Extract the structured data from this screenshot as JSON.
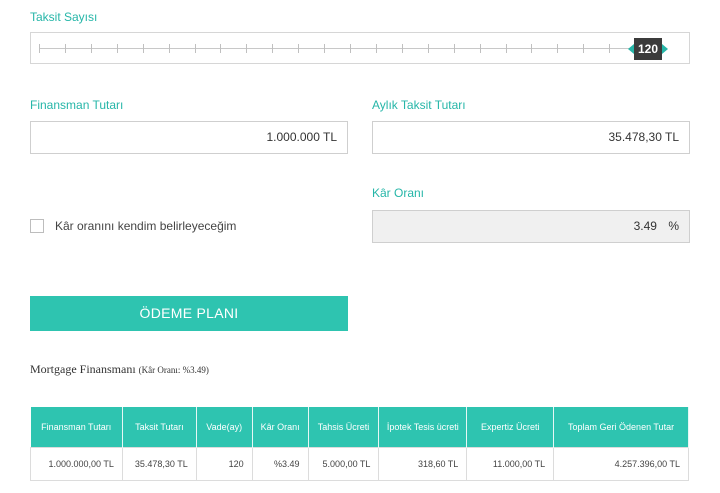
{
  "slider": {
    "label": "Taksit Sayısı",
    "value": "120",
    "fraction": 0.93,
    "tick_count": 25
  },
  "financing_amount": {
    "label": "Finansman Tutarı",
    "value": "1.000.000 TL"
  },
  "monthly_installment": {
    "label": "Aylık Taksit Tutarı",
    "value": "35.478,30 TL"
  },
  "profit_rate": {
    "label": "Kâr Oranı",
    "value": "3.49",
    "unit": "%"
  },
  "custom_rate_checkbox": {
    "label": "Kâr oranını kendim belirleyeceğim",
    "checked": false
  },
  "payment_plan_button": {
    "label": "ÖDEME PLANI"
  },
  "summary": {
    "title": "Mortgage Finansmanı",
    "subtitle": "(Kâr Oranı: %3.49)"
  },
  "plan_table": {
    "headers": [
      "Finansman Tutarı",
      "Taksit Tutarı",
      "Vade(ay)",
      "Kâr Oranı",
      "Tahsis Ücreti",
      "İpotek Tesis ücreti",
      "Expertiz Ücreti",
      "Toplam Geri Ödenen Tutar"
    ],
    "row": [
      "1.000.000,00 TL",
      "35.478,30 TL",
      "120",
      "%3.49",
      "5.000,00 TL",
      "318,60 TL",
      "11.000,00 TL",
      "4.257.396,00 TL"
    ]
  },
  "colors": {
    "accent": "#2ec4b0",
    "label": "#26b6a8",
    "handle": "#3b3b3b"
  }
}
